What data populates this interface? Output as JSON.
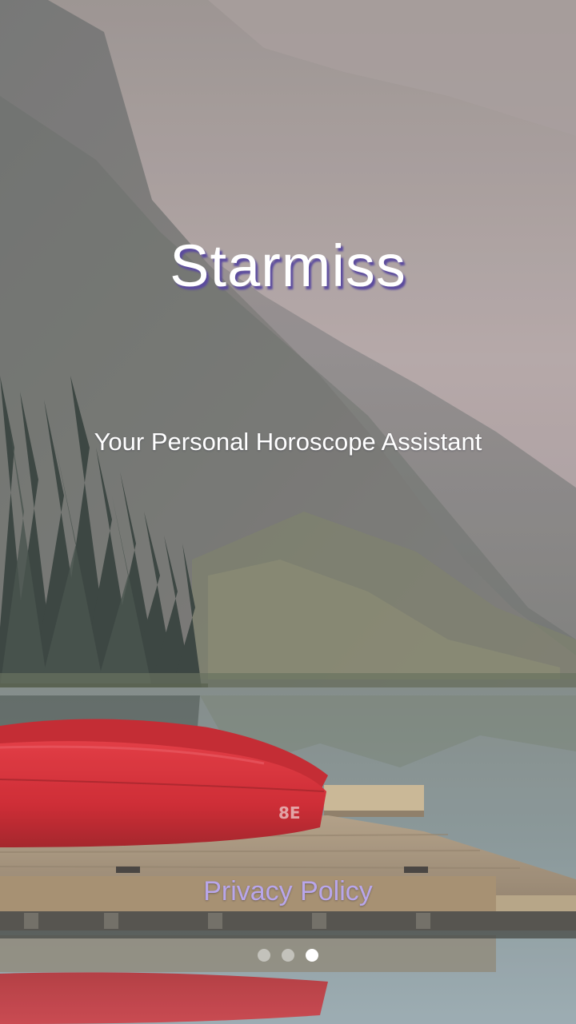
{
  "app": {
    "title": "Starmiss",
    "tagline": "Your Personal Horoscope Assistant"
  },
  "footer": {
    "privacy_label": "Privacy Policy"
  },
  "pager": {
    "pages": 3,
    "active_index": 2
  },
  "colors": {
    "title_shadow": "#5b4b9e",
    "privacy_link": "#b8a6ea",
    "canoe_red": "#d81e26"
  }
}
